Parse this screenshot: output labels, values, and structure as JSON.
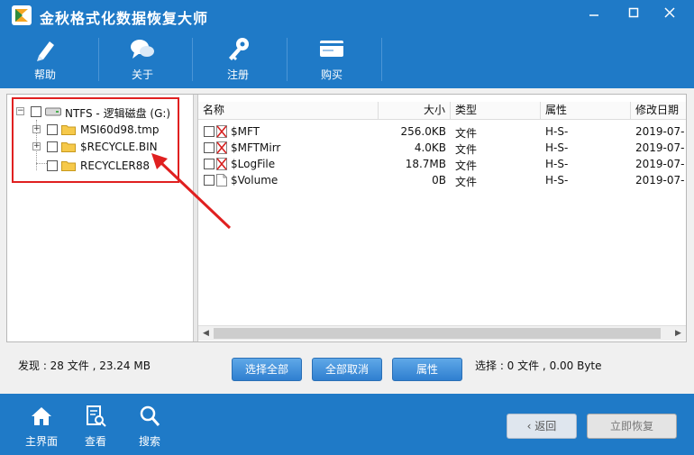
{
  "app": {
    "title": "金秋格式化数据恢复大师"
  },
  "toolbar": {
    "items": [
      {
        "label": "帮助"
      },
      {
        "label": "关于"
      },
      {
        "label": "注册"
      },
      {
        "label": "购买"
      }
    ]
  },
  "tree": {
    "root": "NTFS - 逻辑磁盘 (G:)",
    "children": [
      "MSI60d98.tmp",
      "$RECYCLE.BIN",
      "RECYCLER88"
    ]
  },
  "filelist": {
    "columns": [
      "名称",
      "大小",
      "类型",
      "属性",
      "修改日期"
    ],
    "rows": [
      {
        "name": "$MFT",
        "size": "256.0KB",
        "type": "文件",
        "attr": "H-S-",
        "date": "2019-07-"
      },
      {
        "name": "$MFTMirr",
        "size": "4.0KB",
        "type": "文件",
        "attr": "H-S-",
        "date": "2019-07-"
      },
      {
        "name": "$LogFile",
        "size": "18.7MB",
        "type": "文件",
        "attr": "H-S-",
        "date": "2019-07-"
      },
      {
        "name": "$Volume",
        "size": "0B",
        "type": "文件",
        "attr": "H-S-",
        "date": "2019-07-"
      }
    ]
  },
  "status": {
    "found": "发现 : 28 文件 , 23.24 MB",
    "selected": "选择 : 0 文件 , 0.00 Byte"
  },
  "buttons": {
    "select_all": "选择全部",
    "deselect_all": "全部取消",
    "properties": "属性"
  },
  "bottom": {
    "nav": [
      {
        "label": "主界面"
      },
      {
        "label": "查看"
      },
      {
        "label": "搜索"
      }
    ],
    "back": "返回",
    "start": "立即恢复"
  },
  "colors": {
    "brand_blue": "#1f7ac7",
    "highlight_red": "#e02020"
  }
}
